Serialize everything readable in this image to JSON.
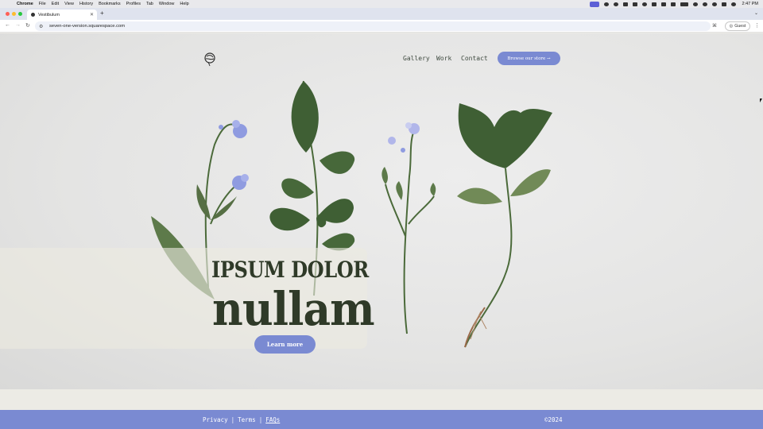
{
  "menubar": {
    "app": "Chrome",
    "items": [
      "File",
      "Edit",
      "View",
      "History",
      "Bookmarks",
      "Profiles",
      "Tab",
      "Window",
      "Help"
    ],
    "clock": "2:47 PM"
  },
  "browser": {
    "tab_title": "Vestibulum",
    "new_tab": "+",
    "url": "seven-one-version.squarespace.com",
    "profile_label": "Guest"
  },
  "site": {
    "nav": {
      "gallery": "Gallery",
      "work": "Work",
      "contact": "Contact",
      "store_button": "Browse our store →"
    },
    "hero": {
      "headline_line1": "IPSUM DOLOR",
      "headline_line2": "nullam",
      "cta": "Learn more"
    },
    "footer": {
      "privacy": "Privacy",
      "terms": "Terms",
      "faqs": "FAQs",
      "separator": "|",
      "copyright": "©2024"
    }
  },
  "colors": {
    "accent": "#7a8ad2",
    "headline": "#2f3a28",
    "leaf": "#3f5f34",
    "flower": "#8f9be0"
  }
}
